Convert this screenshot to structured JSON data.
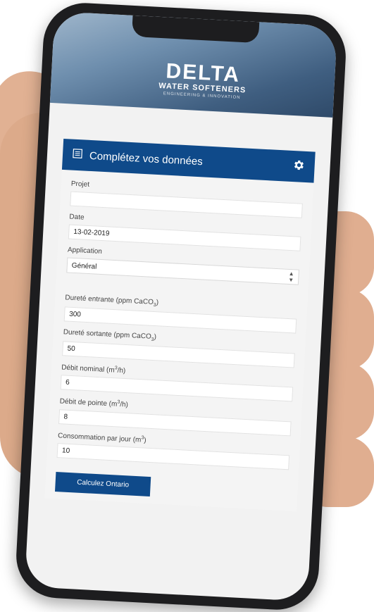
{
  "brand": {
    "name": "DELTA",
    "subtitle": "WATER SOFTENERS",
    "tagline": "ENGINEERING & INNOVATION"
  },
  "card": {
    "title": "Complétez vos données"
  },
  "form": {
    "projet": {
      "label": "Projet",
      "value": ""
    },
    "date": {
      "label": "Date",
      "value": "13-02-2019"
    },
    "application": {
      "label": "Application",
      "value": "Général"
    },
    "durete_entrante": {
      "label_prefix": "Dureté entrante (ppm CaCO",
      "label_sub": "3",
      "label_suffix": ")",
      "value": "300"
    },
    "durete_sortante": {
      "label_prefix": "Dureté sortante (ppm CaCO",
      "label_sub": "3",
      "label_suffix": ")",
      "value": "50"
    },
    "debit_nominal": {
      "label_prefix": "Débit nominal (m",
      "label_sup": "3",
      "label_suffix": "/h)",
      "value": "6"
    },
    "debit_pointe": {
      "label_prefix": "Débit de pointe (m",
      "label_sup": "3",
      "label_suffix": "/h)",
      "value": "8"
    },
    "consommation": {
      "label_prefix": "Consommation par jour (m",
      "label_sup": "3",
      "label_suffix": ")",
      "value": "10"
    }
  },
  "actions": {
    "submit_label": "Calculez Ontario"
  },
  "colors": {
    "primary": "#0f4a8a",
    "form_bg": "#f4f4f4"
  },
  "icons": {
    "header_left": "form-icon",
    "header_right": "gear-icon"
  }
}
